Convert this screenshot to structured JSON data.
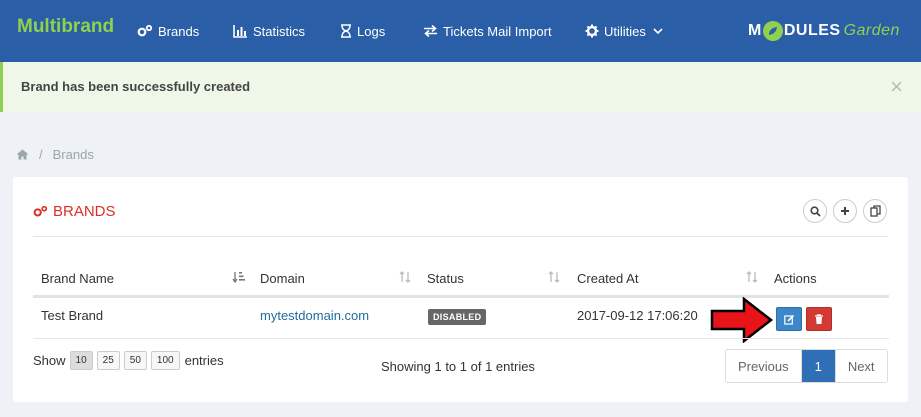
{
  "app": {
    "title": "Multibrand"
  },
  "nav": [
    {
      "label": "Brands",
      "icon": "cogs-icon"
    },
    {
      "label": "Statistics",
      "icon": "bar-chart-icon"
    },
    {
      "label": "Logs",
      "icon": "hourglass-icon"
    },
    {
      "label": "Tickets Mail Import",
      "icon": "exchange-icon"
    },
    {
      "label": "Utilities",
      "icon": "cog-icon"
    }
  ],
  "logo": {
    "text_a": "M",
    "text_b": "DULES",
    "text_c": "Garden"
  },
  "alert": {
    "message": "Brand has been successfully created",
    "close": "×"
  },
  "breadcrumb": {
    "current": "Brands",
    "separator": "/"
  },
  "panel": {
    "title": "BRANDS"
  },
  "table": {
    "columns": [
      "Brand Name",
      "Domain",
      "Status",
      "Created At",
      "Actions"
    ],
    "rows": [
      {
        "name": "Test Brand",
        "domain": "mytestdomain.com",
        "status": "DISABLED",
        "created": "2017-09-12 17:06:20"
      }
    ]
  },
  "length": {
    "prefix": "Show",
    "options": [
      "10",
      "25",
      "50",
      "100"
    ],
    "selected": "10",
    "suffix": "entries"
  },
  "info": "Showing 1 to 1 of 1 entries",
  "pager": {
    "previous": "Previous",
    "page": "1",
    "next": "Next"
  },
  "colors": {
    "nav": "#2a5ea7",
    "accent_green": "#8fd14f",
    "title_red": "#d9312a",
    "edit_blue": "#3d87c8",
    "delete_red": "#d33a34"
  }
}
